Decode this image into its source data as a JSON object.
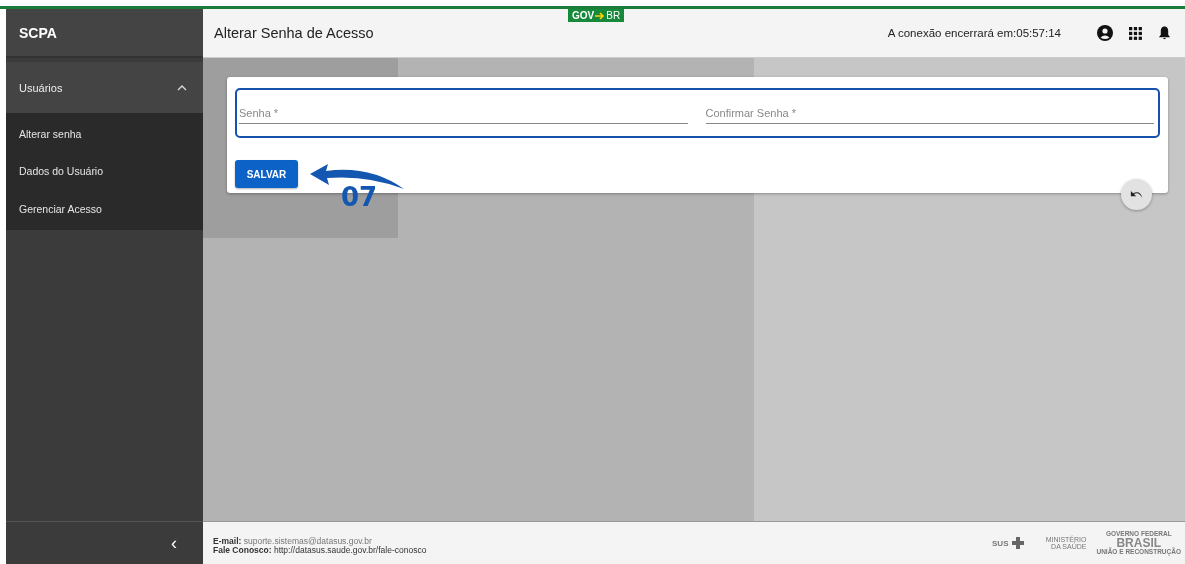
{
  "sidebar": {
    "title": "SCPA",
    "menu": [
      {
        "label": "Usuários",
        "expanded": true,
        "children": [
          {
            "label": "Alterar senha"
          },
          {
            "label": "Dados do Usuário"
          },
          {
            "label": "Gerenciar Acesso"
          }
        ]
      }
    ],
    "collapse_glyph": "‹"
  },
  "header": {
    "title": "Alterar Senha de Acesso",
    "gov_badge": [
      "GOV",
      "BR"
    ],
    "session_text": "A conexão encerrará em:",
    "session_time": "05:57:14"
  },
  "form": {
    "fields": [
      {
        "placeholder": "Senha *"
      },
      {
        "placeholder": "Confirmar Senha *"
      }
    ],
    "save_button": "SALVAR",
    "annotation": "07"
  },
  "footer": {
    "email_label": "E-mail:",
    "email": "suporte.sistemas@datasus.gov.br",
    "contact_label": "Fale Conosco:",
    "contact": "http://datasus.saude.gov.br/fale-conosco",
    "logos": {
      "sus": "SUS",
      "ministry": "MINISTÉRIO DA SAÚDE",
      "gov_top": "GOVERNO FEDERAL",
      "gov_main": "BRASIL",
      "gov_bottom": "UNIÃO E RECONSTRUÇÃO"
    }
  }
}
